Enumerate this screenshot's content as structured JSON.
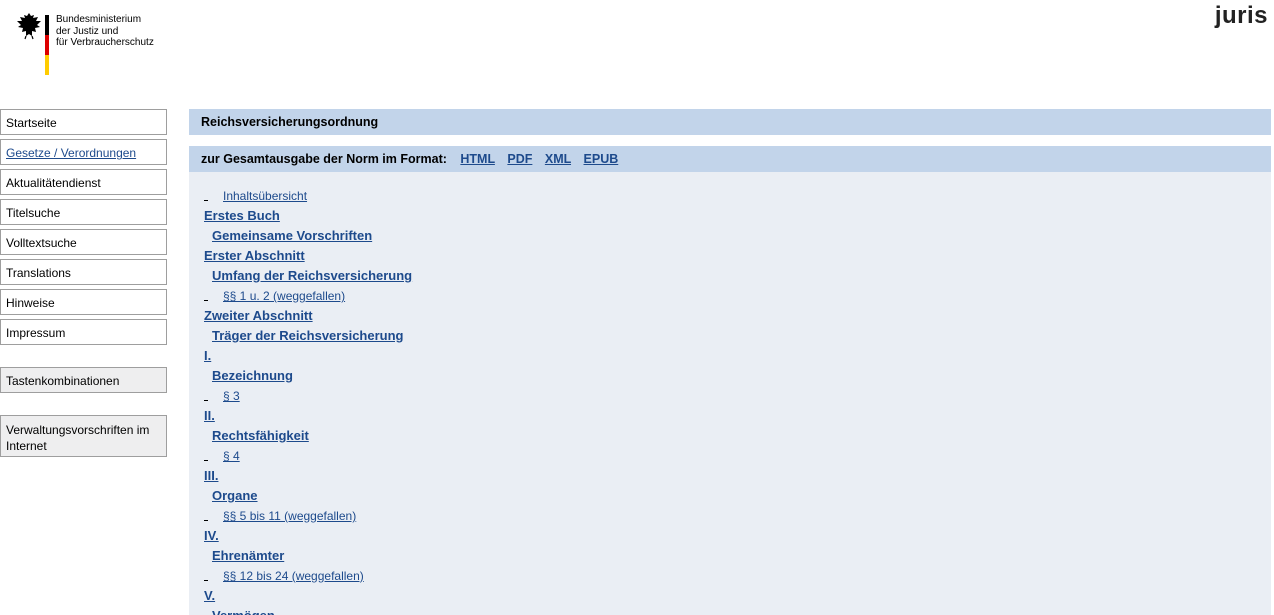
{
  "header": {
    "ministry_lines": [
      "Bundesministerium",
      "der Justiz und",
      "für Verbraucherschutz"
    ],
    "juris_logo": "juris"
  },
  "sidebar": {
    "items": [
      {
        "label": "Startseite"
      },
      {
        "label": "Gesetze / Verordnungen",
        "active": true
      },
      {
        "label": "Aktualitätendienst"
      },
      {
        "label": "Titelsuche"
      },
      {
        "label": "Volltextsuche"
      },
      {
        "label": "Translations"
      },
      {
        "label": "Hinweise"
      },
      {
        "label": "Impressum"
      }
    ],
    "tastenkombinationen": "Tastenkombinationen",
    "verwaltungsvorschriften": "Verwaltungsvorschriften im Internet"
  },
  "main": {
    "title": "Reichsversicherungsordnung",
    "format_label": "zur Gesamtausgabe der Norm im Format:",
    "formats": [
      "HTML",
      "PDF",
      "XML",
      "EPUB"
    ],
    "toc": [
      {
        "kind": "norm",
        "text": "Inhaltsübersicht"
      },
      {
        "kind": "heading",
        "text": "Erstes Buch"
      },
      {
        "kind": "title",
        "text": "Gemeinsame Vorschriften"
      },
      {
        "kind": "heading",
        "text": "Erster Abschnitt"
      },
      {
        "kind": "title",
        "text": "Umfang der Reichsversicherung"
      },
      {
        "kind": "norm",
        "text": "§§ 1 u. 2 (weggefallen)"
      },
      {
        "kind": "heading",
        "text": "Zweiter Abschnitt"
      },
      {
        "kind": "title",
        "text": "Träger der Reichsversicherung"
      },
      {
        "kind": "heading",
        "text": "I."
      },
      {
        "kind": "title",
        "text": "Bezeichnung"
      },
      {
        "kind": "norm",
        "text": "§ 3"
      },
      {
        "kind": "heading",
        "text": "II."
      },
      {
        "kind": "title",
        "text": "Rechtsfähigkeit"
      },
      {
        "kind": "norm",
        "text": "§ 4"
      },
      {
        "kind": "heading",
        "text": "III."
      },
      {
        "kind": "title",
        "text": "Organe"
      },
      {
        "kind": "norm",
        "text": "§§ 5 bis 11 (weggefallen)"
      },
      {
        "kind": "heading",
        "text": "IV."
      },
      {
        "kind": "title",
        "text": "Ehrenämter"
      },
      {
        "kind": "norm",
        "text": "§§ 12 bis 24 (weggefallen)"
      },
      {
        "kind": "heading",
        "text": "V."
      },
      {
        "kind": "title",
        "text": "Vermögen"
      }
    ]
  },
  "colors": {
    "bar_bg": "#c2d4ea",
    "content_bg": "#eaeef4",
    "link": "#1d4a8c"
  }
}
